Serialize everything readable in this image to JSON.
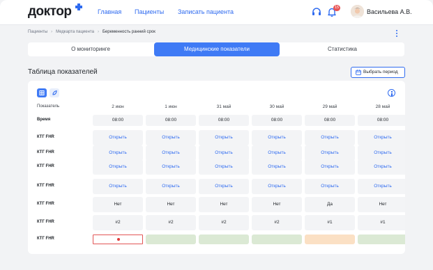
{
  "app": {
    "logo": "доктор"
  },
  "nav": [
    "Главная",
    "Пациенты",
    "Записать пациента"
  ],
  "header": {
    "notifications_count": "15",
    "user_name": "Васильева А.В."
  },
  "breadcrumb": [
    "Пациенты",
    "Медкарта пациента",
    "Беременность ранний срок"
  ],
  "tabs": [
    {
      "label": "О мониторинге",
      "active": false
    },
    {
      "label": "Медицинские показатели",
      "active": true
    },
    {
      "label": "Статистика",
      "active": false
    }
  ],
  "section": {
    "title": "Таблица показателей",
    "period_button": "Выбрать период"
  },
  "table": {
    "header_label": "Показатель",
    "dates": [
      "2 июн",
      "1 июн",
      "31 май",
      "30 май",
      "29 май",
      "28 май"
    ],
    "rows": [
      {
        "label": "Время",
        "cells": [
          "08:00",
          "08:00",
          "08:00",
          "08:00",
          "08:00",
          "08:00"
        ]
      },
      {
        "label": "КТГ FHR",
        "cells": [
          "Открыть",
          "Открыть",
          "Открыть",
          "Открыть",
          "Открыть",
          "Открыть"
        ]
      },
      {
        "label": "КТГ FHR",
        "cells": [
          "Открыть",
          "Открыть",
          "Открыть",
          "Открыть",
          "Открыть",
          "Открыть"
        ]
      },
      {
        "label": "КТГ FHR",
        "cells": [
          "Открыть",
          "Открыть",
          "Открыть",
          "Открыть",
          "Открыть",
          "Открыть"
        ]
      },
      {
        "label": "КТГ FHR",
        "cells": [
          "Открыть",
          "Открыть",
          "Открыть",
          "Открыть",
          "Открыть",
          "Открыть"
        ]
      },
      {
        "label": "КТГ FHR",
        "cells": [
          "Нет",
          "Нет",
          "Нет",
          "Нет",
          "Да",
          "Нет"
        ]
      },
      {
        "label": "КТГ FHR",
        "cells": [
          "#2",
          "#2",
          "#2",
          "#2",
          "#1",
          "#1"
        ]
      },
      {
        "label": "КТГ FHR",
        "status_cells": [
          "red-dot",
          "green",
          "green",
          "green",
          "orange",
          "green"
        ]
      }
    ]
  },
  "colors": {
    "accent": "#3f7af5",
    "status_red": "#e03a3a",
    "status_green": "#dbe9d4",
    "status_orange": "#fbe0c4"
  }
}
